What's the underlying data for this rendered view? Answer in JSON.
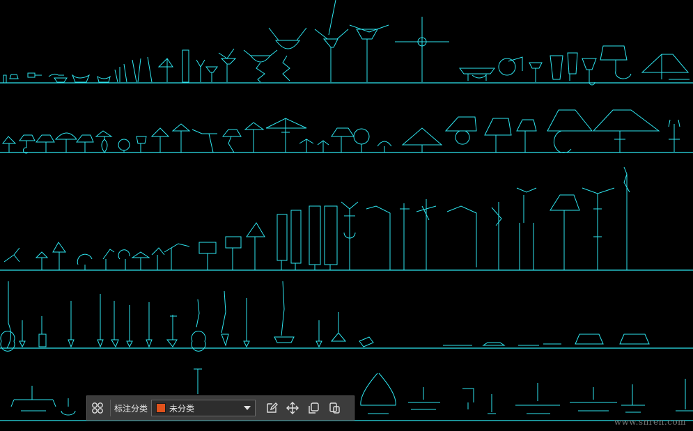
{
  "toolbar": {
    "classify_label": "标注分类",
    "category_value": "未分类",
    "category_color": "#e0521c",
    "icons": [
      "grid-icon",
      "edit-icon",
      "move-icon",
      "copy-icon",
      "paste-icon"
    ]
  },
  "watermark": "www.snren.com",
  "colors": {
    "cad_line": "#2ee6f0",
    "background": "#000000",
    "toolbar_bg": "#3c3c3c"
  }
}
